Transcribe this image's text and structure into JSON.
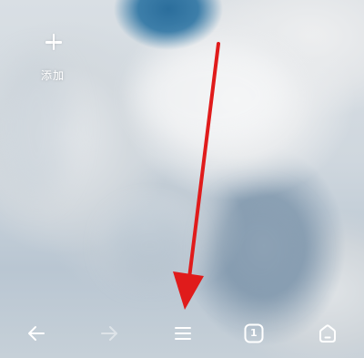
{
  "home": {
    "add_shortcut_label": "添加",
    "add_icon": "plus-icon"
  },
  "toolbar": {
    "back_icon": "back-arrow-icon",
    "forward_icon": "forward-arrow-icon",
    "menu_icon": "hamburger-menu-icon",
    "tabs_icon": "tabs-icon",
    "tab_count": "1",
    "home_icon": "home-icon",
    "forward_enabled": false
  },
  "annotation": {
    "arrow_color": "#e01b1b",
    "points_to": "hamburger-menu-icon"
  },
  "colors": {
    "sky": "#2b6e9c",
    "icon_white": "#ffffff"
  }
}
